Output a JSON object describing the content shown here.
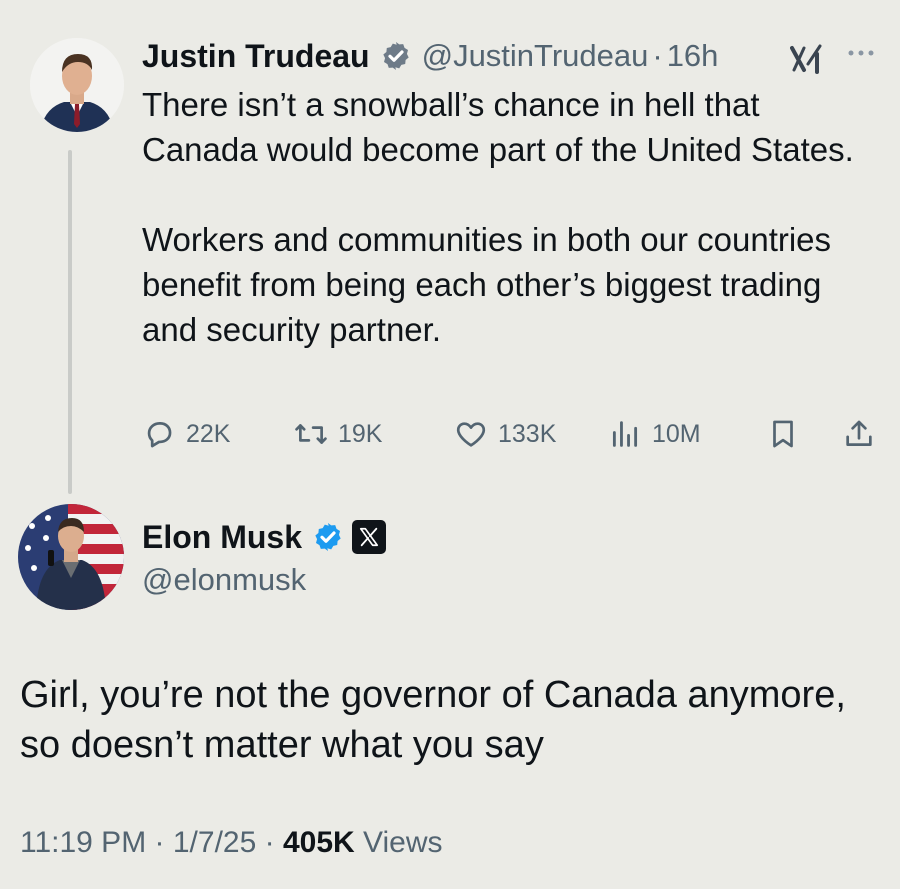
{
  "parent_tweet": {
    "author_name": "Justin Trudeau",
    "handle": "@JustinTrudeau",
    "separator": "·",
    "time": "16h",
    "text_paragraphs": [
      "There isn’t a snowball’s chance in hell that Canada would become part of the United States.",
      "Workers and communities in both our countries benefit from being each other’s biggest trading and security partner."
    ],
    "actions": {
      "reply_count": "22K",
      "retweet_count": "19K",
      "like_count": "133K",
      "views_count": "10M"
    },
    "icons": {
      "verified": "verified-badge-icon",
      "grok": "grok-icon",
      "more": "more-icon"
    }
  },
  "main_tweet": {
    "author_name": "Elon Musk",
    "handle": "@elonmusk",
    "text": "Girl, you’re not the governor of Canada anymore, so doesn’t matter what you say",
    "time": "11:19 PM",
    "date": "1/7/25",
    "separator": "·",
    "views_count": "405K",
    "views_label": "Views"
  },
  "colors": {
    "background": "#ebebe6",
    "primary_text": "#0f1419",
    "secondary_text": "#536471",
    "verified_blue": "#1d9bf0",
    "thread_line": "#c9cbc8"
  }
}
